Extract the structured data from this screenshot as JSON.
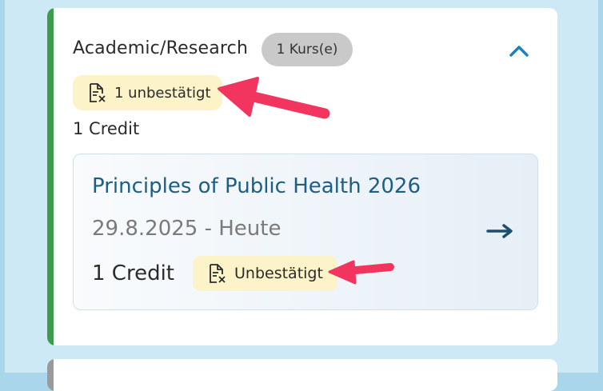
{
  "category": {
    "title": "Academic/Research",
    "count_badge": "1 Kurs(e)",
    "unconfirmed_badge": "1 unbestätigt",
    "credit": "1 Credit",
    "accent_color": "#3e9a4c",
    "collapse_icon": "chevron-up-icon"
  },
  "course": {
    "title": "Principles of Public Health 2026",
    "dates": "29.8.2025 - Heute",
    "credit": "1 Credit",
    "status_badge": "Unbestätigt",
    "status_icon": "document-unconfirmed-icon",
    "open_icon": "arrow-right-icon",
    "title_color": "#1b5e86"
  },
  "annotations": {
    "arrow_color": "#f2355f"
  }
}
